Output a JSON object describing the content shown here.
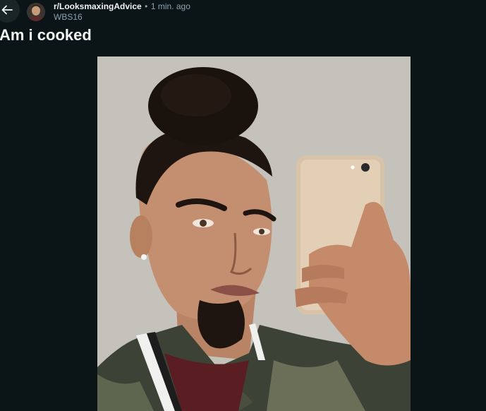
{
  "header": {
    "subreddit": "r/LooksmaxingAdvice",
    "separator": "•",
    "time": "1 min. ago",
    "author": "WBS16"
  },
  "post": {
    "title": "Am i cooked"
  },
  "icons": {
    "back": "arrow-left-icon",
    "avatar": "subreddit-avatar"
  },
  "colors": {
    "background": "#0b1416",
    "title": "#f2f4f5",
    "meta": "#8ba2ad",
    "back_button_bg": "#1a2528"
  }
}
